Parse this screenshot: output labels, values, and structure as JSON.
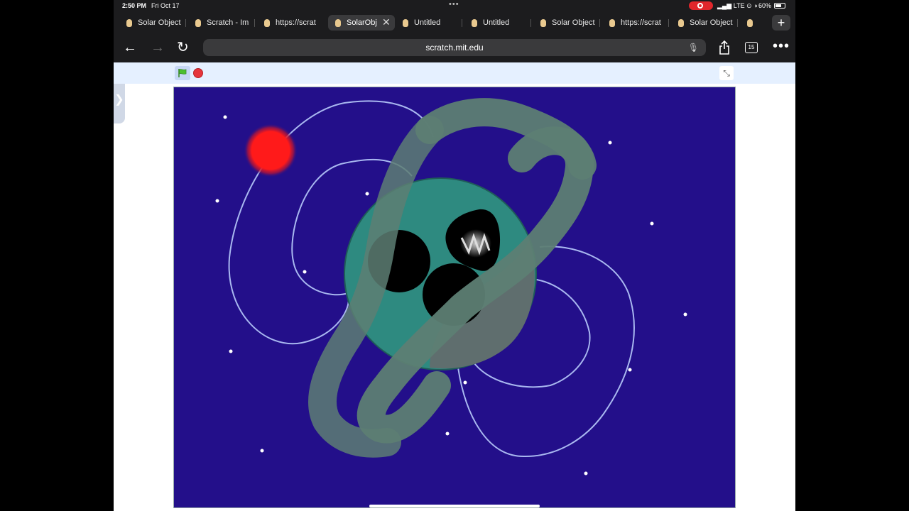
{
  "status_bar": {
    "time": "2:50 PM",
    "date": "Fri Oct 17",
    "signal": "LTE",
    "battery": "60%"
  },
  "tabs": [
    {
      "label": "Solar Object",
      "active": false
    },
    {
      "label": "Scratch - Im",
      "active": false
    },
    {
      "label": "https://scrat",
      "active": false
    },
    {
      "label": "SolarObj",
      "active": true
    },
    {
      "label": "Untitled",
      "active": false
    },
    {
      "label": "Untitled",
      "active": false
    },
    {
      "label": "Solar Object",
      "active": false
    },
    {
      "label": "https://scrat",
      "active": false
    },
    {
      "label": "Solar Object",
      "active": false
    }
  ],
  "toolbar": {
    "url": "scratch.mit.edu",
    "tab_count": "15"
  },
  "icons": {
    "back": "back-arrow-icon",
    "forward": "forward-arrow-icon",
    "reload": "reload-icon",
    "mic": "microphone-icon",
    "share": "share-icon",
    "more": "more-icon",
    "green_flag": "green-flag-icon",
    "stop": "stop-icon",
    "fullscreen_exit": "exit-fullscreen-icon"
  },
  "colors": {
    "stage_bg": "#230f8a",
    "sun": "#ff1a1a",
    "planet": "#2e8a80",
    "ring": "#5d7e73",
    "orbit": "#a9b8f0"
  }
}
